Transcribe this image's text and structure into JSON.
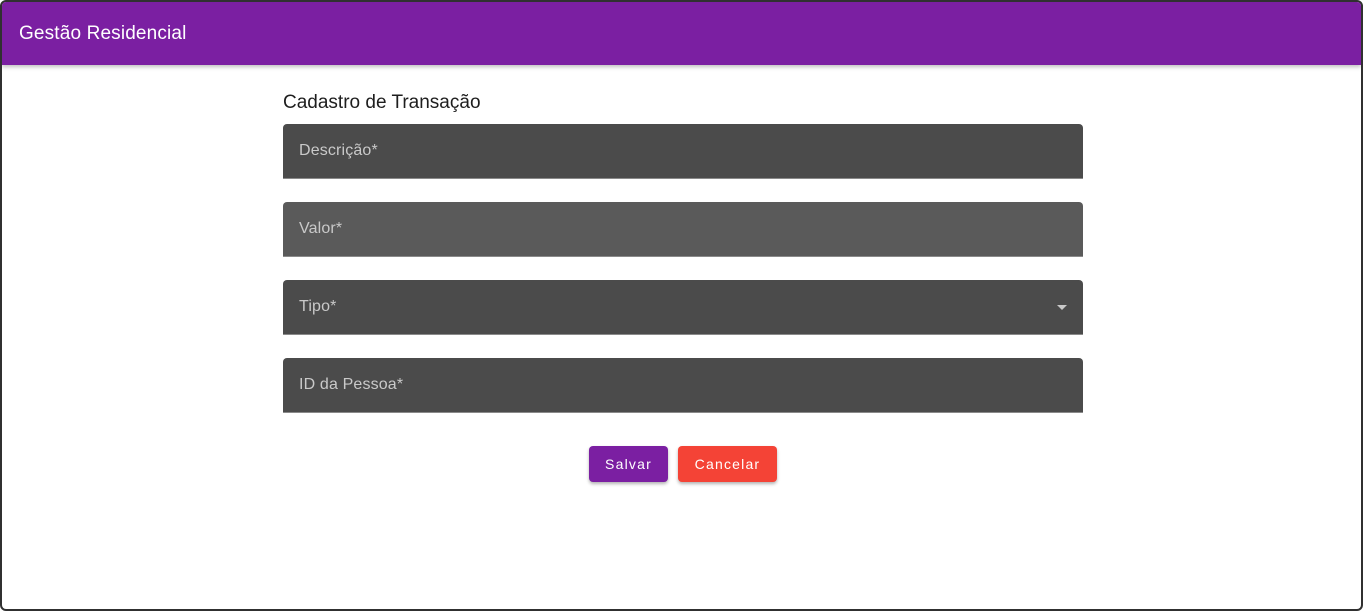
{
  "app": {
    "title": "Gestão Residencial"
  },
  "form": {
    "title": "Cadastro de Transação",
    "fields": [
      {
        "label": "Descrição*",
        "type": "text"
      },
      {
        "label": "Valor*",
        "type": "text"
      },
      {
        "label": "Tipo*",
        "type": "select"
      },
      {
        "label": "ID da Pessoa*",
        "type": "text"
      }
    ],
    "actions": {
      "save_label": "Salvar",
      "cancel_label": "Cancelar"
    }
  },
  "colors": {
    "primary": "#7b1fa2",
    "danger": "#f44336",
    "field_bg": "#4b4b4b"
  },
  "icons": {
    "select_arrow": "arrow-drop-down-icon"
  }
}
